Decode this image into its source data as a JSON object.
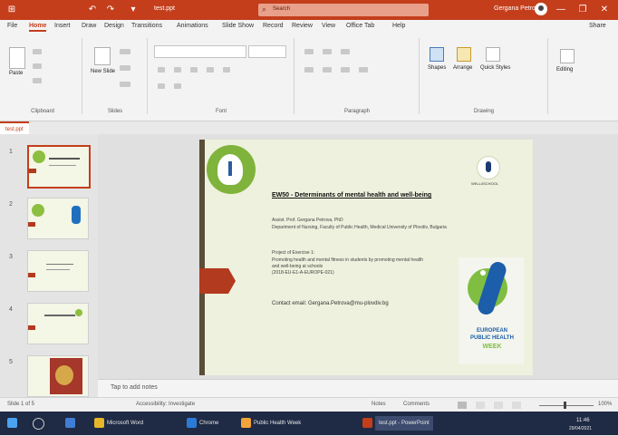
{
  "titlebar": {
    "qat": [
      "⊞",
      "↶",
      "↷",
      "▾"
    ],
    "doc_title": "test.ppt",
    "search_placeholder": "Search",
    "user": "Gergana Petrova",
    "controls": [
      "—",
      "❐",
      "✕"
    ]
  },
  "menu": {
    "tabs": [
      "File",
      "Home",
      "Insert",
      "Draw",
      "Design",
      "Transitions",
      "Animations",
      "Slide Show",
      "Record",
      "Review",
      "View",
      "Office Tab",
      "Help"
    ],
    "share": "Share"
  },
  "ribbon": {
    "groups": [
      "Clipboard",
      "Slides",
      "Font",
      "Paragraph",
      "Drawing"
    ],
    "paste_label": "Paste",
    "new_slide_label": "New Slide",
    "shapes_label": "Shapes",
    "arrange_label": "Arrange",
    "styles_label": "Quick Styles",
    "editing_label": "Editing"
  },
  "doc_tab": {
    "label": "test.ppt"
  },
  "slides": {
    "numbers": [
      "1",
      "2",
      "3",
      "4",
      "5"
    ],
    "main": {
      "title": "EW50 - Determinants of mental health and well-being",
      "author_line": "Assist. Prof. Gergana Petrova, PhD",
      "author_dept": "Department of Nursing, Faculty of Public Health, Medical University of Plovdiv, Bulgaria",
      "project_title": "Project of Exercise 1:",
      "project_lines": [
        "Promoting health and mental fitness in students by promoting mental health",
        "and well-being at schools",
        "(2018-EU-E1-A-EUROPE-021)"
      ],
      "contact": "Contact email: Gergana.Petrova@mu-plovdiv.bg",
      "logo_text": "WELL4SCHOOL",
      "euphw": [
        "EUROPEAN",
        "PUBLIC HEALTH",
        "WEEK"
      ]
    }
  },
  "notes": {
    "placeholder": "Tap to add notes"
  },
  "statusbar": {
    "slide_info": "Slide 1 of 5",
    "accessibility": "Accessibility: Investigate",
    "notes": "Notes",
    "comments": "Comments",
    "zoom": "100%"
  },
  "taskbar": {
    "items": [
      "Microsoft Word",
      "Chrome",
      "Public Health Week",
      "test.ppt - PowerPoint"
    ],
    "time": "11:46",
    "date": "29/04/2021"
  }
}
